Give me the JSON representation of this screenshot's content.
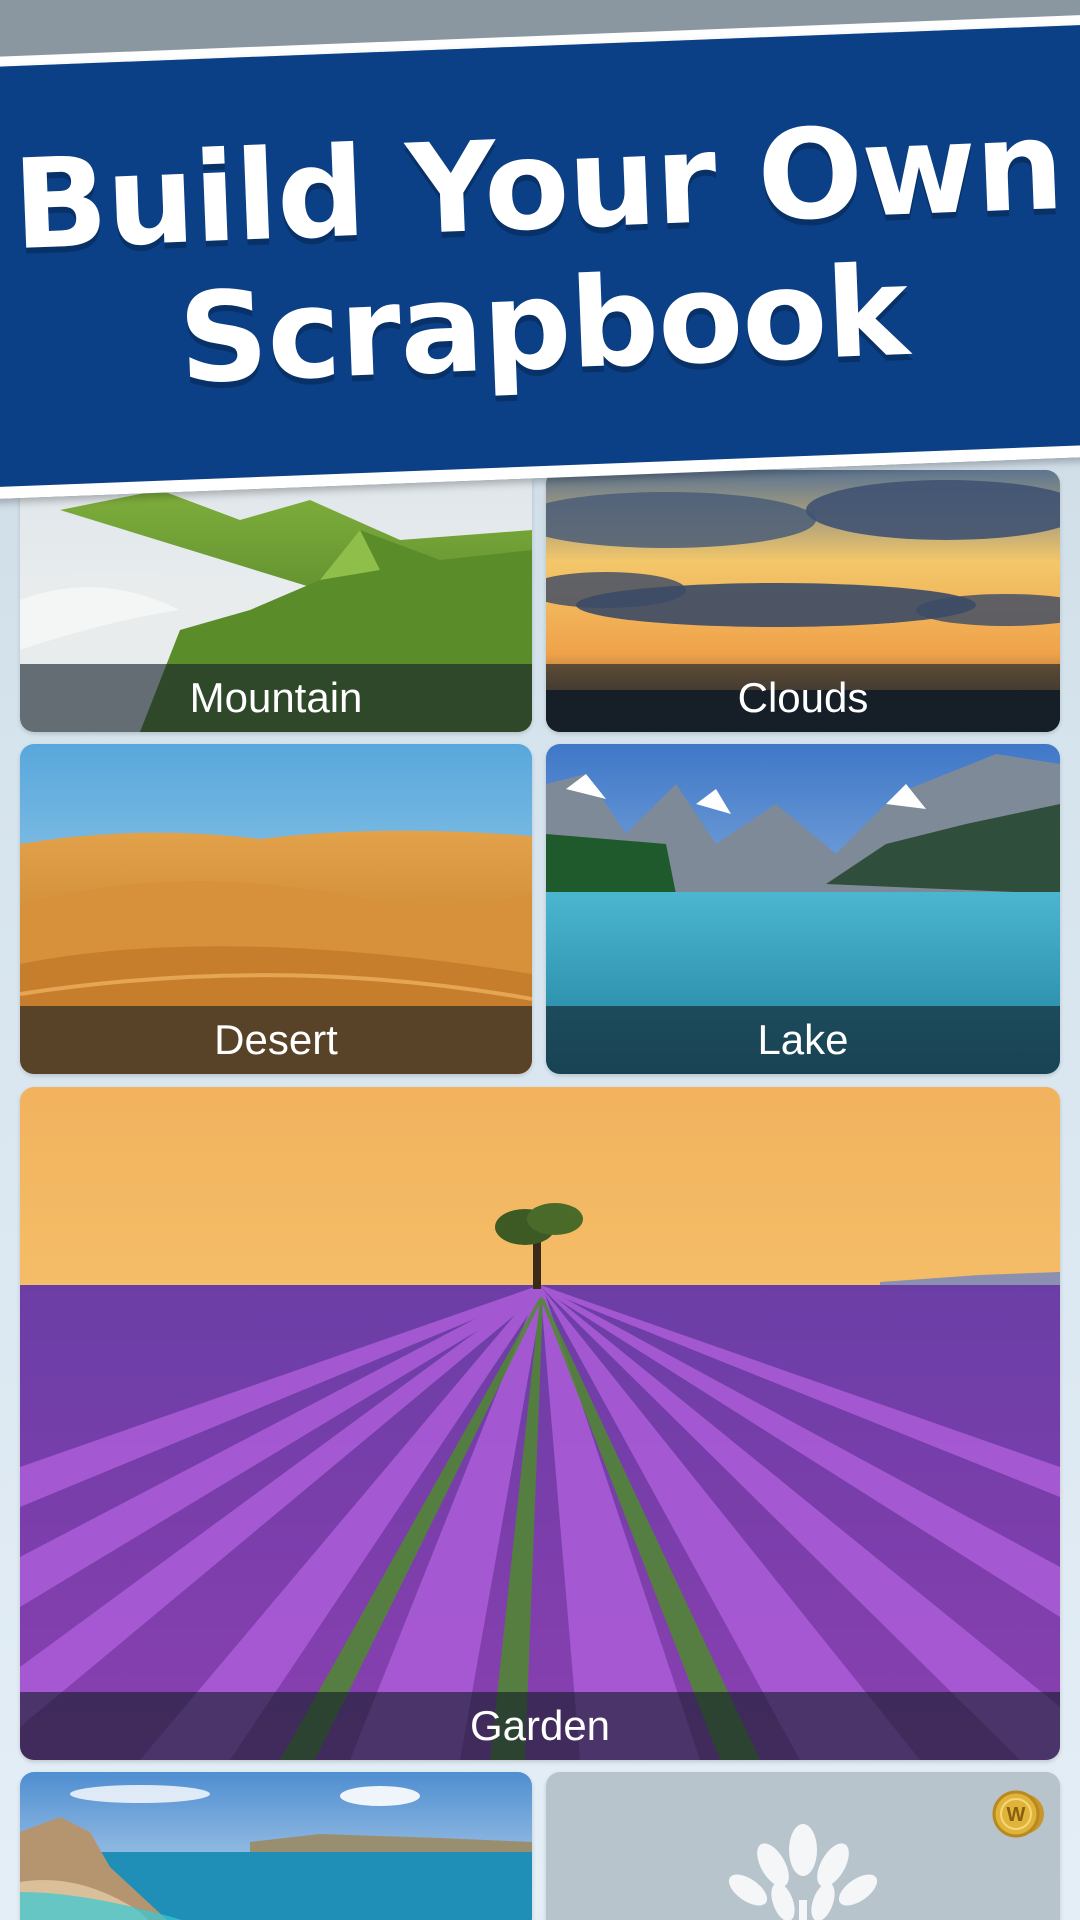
{
  "banner": {
    "line1": "Build Your Own",
    "line2": "Scrapbook"
  },
  "tiles": [
    {
      "id": "mountain",
      "label": "Mountain"
    },
    {
      "id": "clouds",
      "label": "Clouds"
    },
    {
      "id": "desert",
      "label": "Desert"
    },
    {
      "id": "lake",
      "label": "Lake"
    },
    {
      "id": "garden",
      "label": "Garden"
    },
    {
      "id": "beach",
      "label": ""
    },
    {
      "id": "locked",
      "label": ""
    }
  ],
  "coin": {
    "symbol": "W"
  },
  "colors": {
    "banner_blue": "#0b3f86",
    "caption_bg": "#141e28",
    "coin_gold": "#e0b43a"
  },
  "icons": {
    "coin": "coin-icon",
    "locked_tile": "tree-silhouette-icon"
  }
}
